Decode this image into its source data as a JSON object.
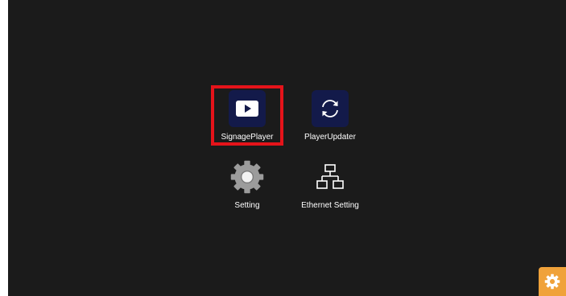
{
  "apps": [
    {
      "label": "SignagePlayer",
      "icon": "play-icon",
      "icon_bg": "#131a4a"
    },
    {
      "label": "PlayerUpdater",
      "icon": "refresh-icon",
      "icon_bg": "#131a4a"
    },
    {
      "label": "Setting",
      "icon": "gear-icon",
      "icon_color": "#9e9e9e"
    },
    {
      "label": "Ethernet Setting",
      "icon": "network-icon",
      "icon_color": "#ffffff"
    }
  ],
  "highlight_color": "#e5131a",
  "settings_fab": {
    "icon": "gear-icon",
    "bg": "#f0a23a"
  },
  "screen_bg": "#1b1b1b"
}
